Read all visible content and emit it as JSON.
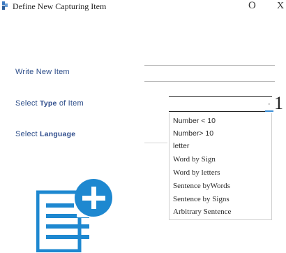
{
  "window": {
    "title": "Define New Capturing Item",
    "minimize_label": "O",
    "close_label": "X"
  },
  "form": {
    "write_label": "Write New Item",
    "select_type_prefix": "Select",
    "select_type_bold": "Type",
    "select_type_suffix": "of Item",
    "select_language_prefix": "Select",
    "select_language_bold": "Language",
    "name_value": "",
    "selected_type": "",
    "select_marker": "·",
    "select_arrow": "1"
  },
  "type_options": [
    "Number < 10",
    "Number>  10",
    "letter",
    "Word by Sign",
    "Word by letters",
    "Sentence byWords",
    "Sentence by Signs",
    "Arbitrary Sentence"
  ],
  "colors": {
    "label_blue": "#2f4f8a",
    "icon_blue": "#1e88d0",
    "focus_blue": "#3b8ed6"
  },
  "icons": {
    "app": "app-icon",
    "add_document": "document-add-icon"
  }
}
